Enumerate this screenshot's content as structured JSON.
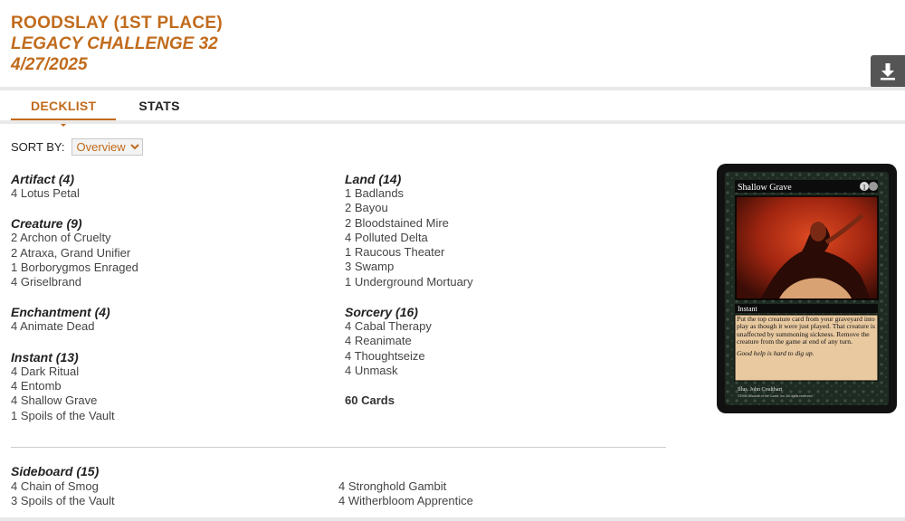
{
  "header": {
    "title": "ROODSLAY (1ST PLACE)",
    "event": "LEGACY CHALLENGE 32",
    "date": "4/27/2025"
  },
  "tabs": [
    {
      "label": "DECKLIST"
    },
    {
      "label": "STATS"
    }
  ],
  "sort": {
    "label": "SORT BY:",
    "selected": "Overview"
  },
  "deck": {
    "artifact": {
      "title": "Artifact (4)",
      "cards": [
        "4 Lotus Petal"
      ]
    },
    "creature": {
      "title": "Creature (9)",
      "cards": [
        "2 Archon of Cruelty",
        "2 Atraxa, Grand Unifier",
        "1 Borborygmos Enraged",
        "4 Griselbrand"
      ]
    },
    "enchantment": {
      "title": "Enchantment (4)",
      "cards": [
        "4 Animate Dead"
      ]
    },
    "instant": {
      "title": "Instant (13)",
      "cards": [
        "4 Dark Ritual",
        "4 Entomb",
        "4 Shallow Grave",
        "1 Spoils of the Vault"
      ]
    },
    "land": {
      "title": "Land (14)",
      "cards": [
        "1 Badlands",
        "2 Bayou",
        "2 Bloodstained Mire",
        "4 Polluted Delta",
        "1 Raucous Theater",
        "3 Swamp",
        "1 Underground Mortuary"
      ]
    },
    "sorcery": {
      "title": "Sorcery (16)",
      "cards": [
        "4 Cabal Therapy",
        "4 Reanimate",
        "4 Thoughtseize",
        "4 Unmask"
      ]
    },
    "total": "60 Cards"
  },
  "sideboard": {
    "title": "Sideboard (15)",
    "col1": [
      "4 Chain of Smog",
      "3 Spoils of the Vault"
    ],
    "col2": [
      "4 Stronghold Gambit",
      "4 Witherbloom Apprentice"
    ]
  },
  "card_preview": {
    "name": "Shallow Grave",
    "mana_cost": "1",
    "type": "Instant",
    "rules_text": "Put the top creature card from your graveyard into play as though it were just played. That creature is unaffected by summoning sickness. Remove the creature from the game at end of any turn.",
    "flavor": "Good help is hard to dig up.",
    "artist": "Illus. John Coulthart",
    "copyright": "©1996 Wizards of the Coast, Inc. All rights reserved."
  },
  "colors": {
    "accent": "#c16b1c",
    "download_bg": "#555555"
  },
  "icons": {
    "download": "download-icon",
    "caret": "caret-down-icon"
  }
}
